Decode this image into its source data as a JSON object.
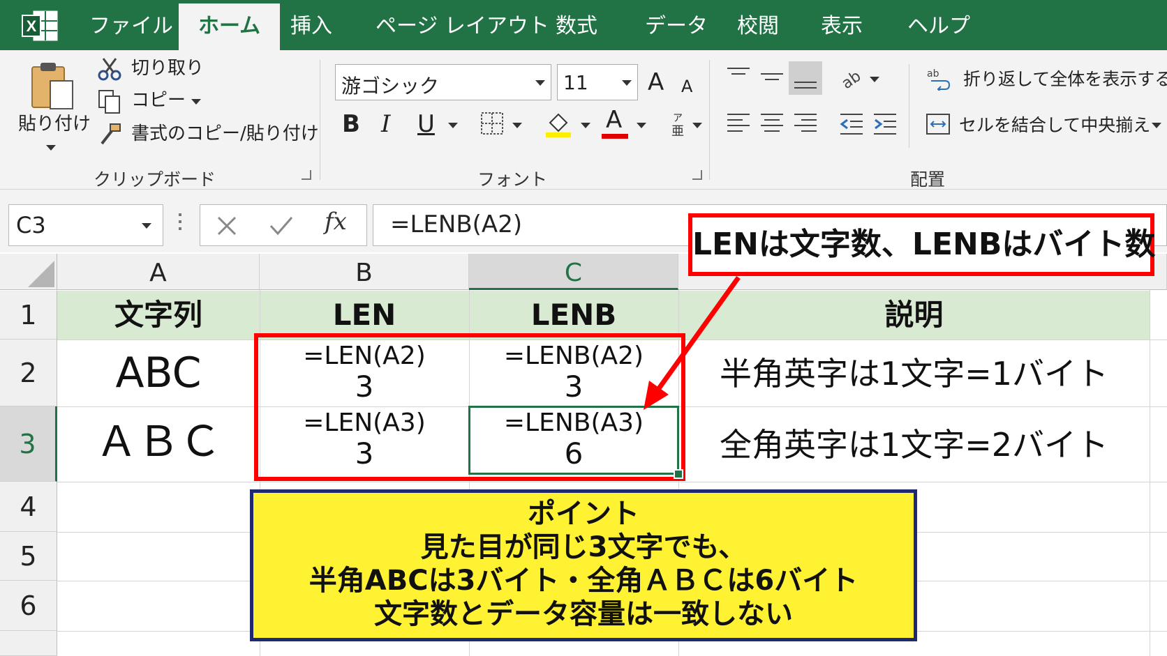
{
  "tabs": {
    "file": "ファイル",
    "home": "ホーム",
    "insert": "挿入",
    "page_layout": "ページ レイアウト",
    "formulas": "数式",
    "data": "データ",
    "review": "校閲",
    "view": "表示",
    "help": "ヘルプ"
  },
  "ribbon": {
    "clipboard": {
      "paste": "貼り付け",
      "cut": "切り取り",
      "copy": "コピー",
      "format_painter": "書式のコピー/貼り付け",
      "label": "クリップボード"
    },
    "font": {
      "font_name": "游ゴシック",
      "font_size": "11",
      "bold": "B",
      "italic": "I",
      "underline": "U",
      "font_color_letter": "A",
      "grow": "A",
      "shrink": "A",
      "label": "フォント"
    },
    "alignment": {
      "wrap_text": "折り返して全体を表示する",
      "merge_center": "セルを結合して中央揃え",
      "label": "配置"
    }
  },
  "formula_bar": {
    "name_box": "C3",
    "fx": "fx",
    "formula": "=LENB(A2)"
  },
  "columns": [
    "A",
    "B",
    "C"
  ],
  "rows": [
    "1",
    "2",
    "3",
    "4",
    "5",
    "6"
  ],
  "sheet": {
    "header": {
      "a": "文字列",
      "b": "LEN",
      "c": "LENB",
      "d": "説明"
    },
    "row2": {
      "a": "ABC",
      "b_formula": "=LEN(A2)",
      "b_value": "3",
      "c_formula": "=LENB(A2)",
      "c_value": "3",
      "d": "半角英字は1文字=1バイト"
    },
    "row3": {
      "a": "ＡＢＣ",
      "b_formula": "=LEN(A3)",
      "b_value": "3",
      "c_formula": "=LENB(A3)",
      "c_value": "6",
      "d": "全角英字は1文字=2バイト"
    }
  },
  "callout": "LENは文字数、LENBはバイト数",
  "point": {
    "title": "ポイント",
    "line1": "見た目が同じ3文字でも、",
    "line2": "半角ABCは3バイト・全角ＡＢＣは6バイト",
    "line3": "文字数とデータ容量は一致しない"
  },
  "colors": {
    "excel_green": "#217346",
    "header_fill": "#d9ead3",
    "highlight_red": "#ff0000",
    "note_yellow": "#fff232",
    "note_border": "#1f2a6e"
  }
}
